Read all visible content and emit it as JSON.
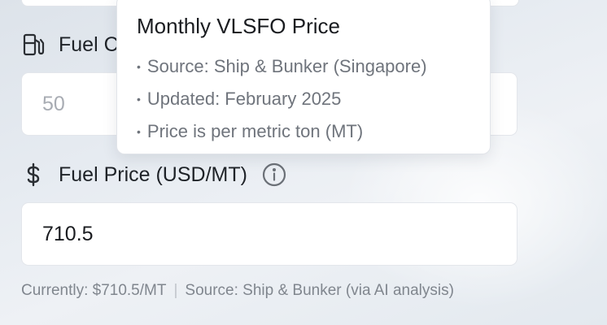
{
  "fuel_consumption": {
    "label": "Fuel C",
    "icon": "fuel-pump-icon",
    "placeholder": "50"
  },
  "fuel_price": {
    "label": "Fuel Price (USD/MT)",
    "icon": "dollar-icon",
    "info_icon": "info-icon",
    "value": "710.5",
    "helper_current": "Currently: $710.5/MT",
    "helper_separator": "|",
    "helper_source": "Source: Ship & Bunker (via AI analysis)"
  },
  "tooltip": {
    "title": "Monthly VLSFO Price",
    "items": [
      "Source: Ship & Bunker (Singapore)",
      "Updated: February 2025",
      "Price is per metric ton (MT)"
    ]
  }
}
